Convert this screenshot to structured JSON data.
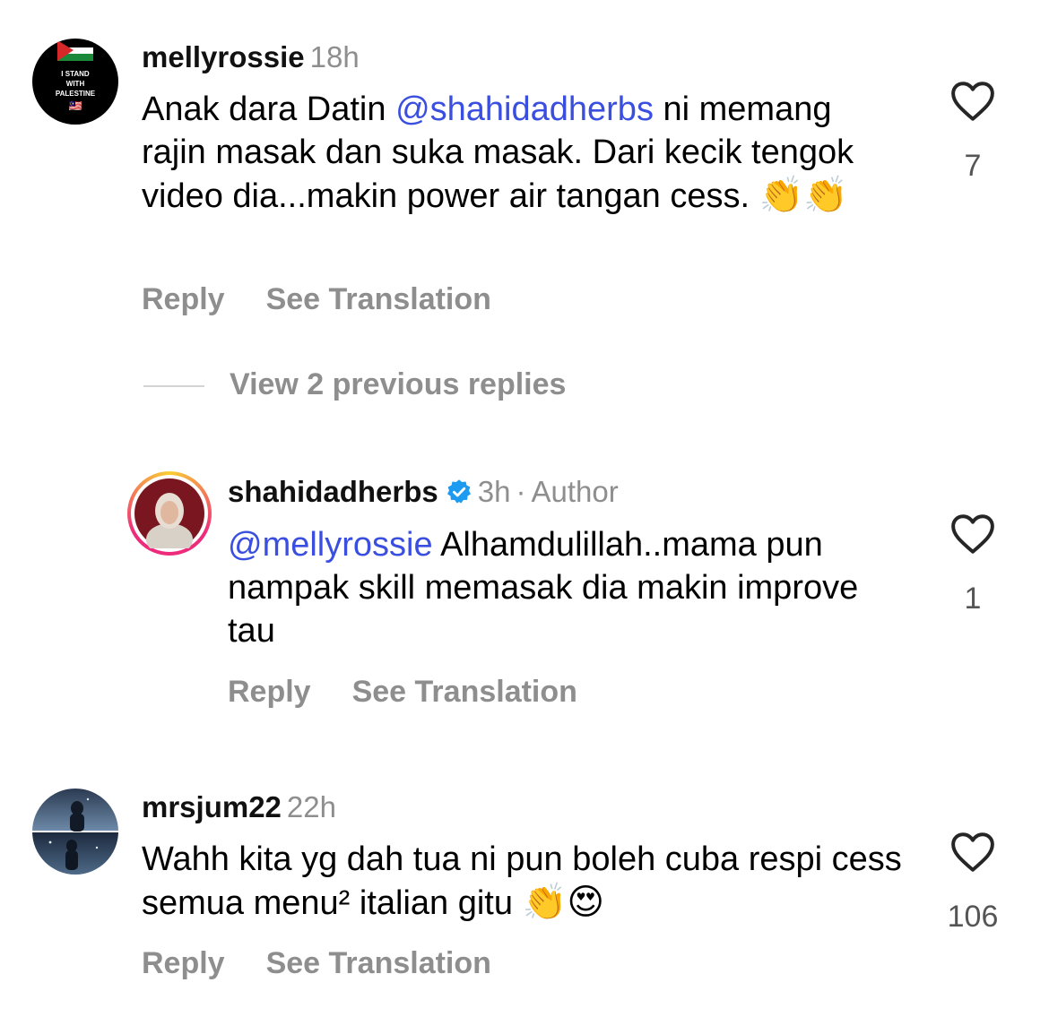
{
  "comments": [
    {
      "username": "mellyrossie",
      "time": "18h",
      "text_before": "Anak dara Datin ",
      "mention": "@shahidadherbs",
      "text_after": " ni memang rajin masak dan suka masak. Dari kecik tengok video dia...makin power air tangan cess. ",
      "emojis": "👏👏",
      "likes": "7",
      "reply_label": "Reply",
      "translate_label": "See Translation",
      "avatar_text": [
        "I STAND",
        "WITH",
        "PALESTINE"
      ],
      "avatar_flag": "🇲🇾"
    },
    {
      "username": "mrsjum22",
      "time": "22h",
      "text": "Wahh kita yg dah tua ni pun boleh cuba respi cess semua menu² italian gitu ",
      "emojis": "👏😍",
      "likes": "106",
      "reply_label": "Reply",
      "translate_label": "See Translation"
    }
  ],
  "view_replies_label": "View 2 previous replies",
  "reply": {
    "username": "shahidadherbs",
    "time": "3h",
    "separator": "·",
    "author_badge": "Author",
    "mention": "@mellyrossie",
    "text": " Alhamdulillah..mama pun nampak skill memasak dia makin improve tau",
    "likes": "1",
    "reply_label": "Reply",
    "translate_label": "See Translation"
  },
  "colors": {
    "mention": "#3a4fe0",
    "muted": "#8e8e8e",
    "verified": "#1d9bf0"
  }
}
